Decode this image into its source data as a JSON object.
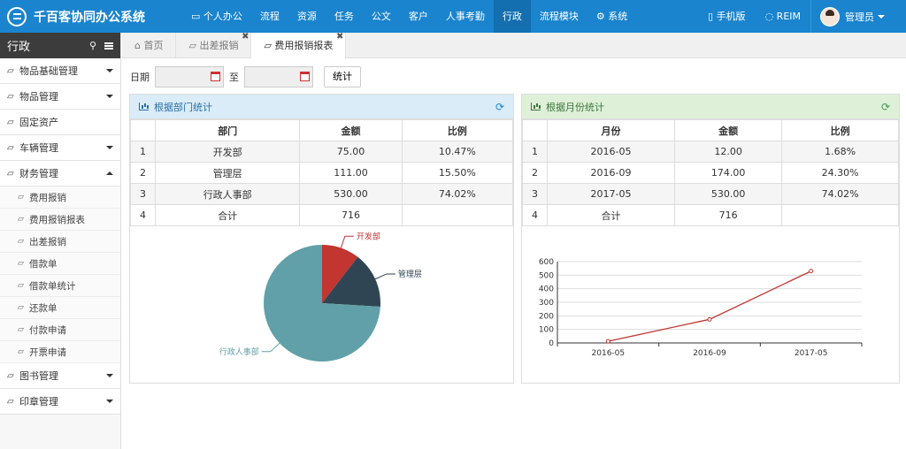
{
  "app": {
    "title": "千百客协同办公系统"
  },
  "nav": [
    {
      "label": "个人办公",
      "icon": "monitor-icon"
    },
    {
      "label": "流程"
    },
    {
      "label": "资源"
    },
    {
      "label": "任务"
    },
    {
      "label": "公文"
    },
    {
      "label": "客户"
    },
    {
      "label": "人事考勤"
    },
    {
      "label": "行政",
      "active": true
    },
    {
      "label": "流程模块"
    },
    {
      "label": "系统",
      "icon": "gear-icon"
    }
  ],
  "nav_right": {
    "mobile": "手机版",
    "reim": "REIM",
    "user": "管理员"
  },
  "sidebar": {
    "title": "行政",
    "items": [
      {
        "label": "物品基础管理",
        "expand": "down"
      },
      {
        "label": "物品管理",
        "expand": "down"
      },
      {
        "label": "固定资产"
      },
      {
        "label": "车辆管理",
        "expand": "down"
      },
      {
        "label": "财务管理",
        "expand": "up"
      }
    ],
    "finance_subs": [
      "费用报销",
      "费用报销报表",
      "出差报销",
      "借款单",
      "借款单统计",
      "还款单",
      "付款申请",
      "开票申请"
    ],
    "items_after": [
      {
        "label": "图书管理",
        "expand": "down"
      },
      {
        "label": "印章管理",
        "expand": "down"
      }
    ]
  },
  "tabs": [
    {
      "label": "首页"
    },
    {
      "label": "出差报销",
      "closable": true
    },
    {
      "label": "费用报销报表",
      "closable": true,
      "active": true
    }
  ],
  "filter": {
    "date_label": "日期",
    "to_label": "至",
    "stat_button": "统计"
  },
  "dept_panel": {
    "title": "根据部门统计",
    "headers": [
      "部门",
      "金额",
      "比例"
    ],
    "rows": [
      {
        "idx": "1",
        "name": "开发部",
        "amount": "75.00",
        "ratio": "10.47%"
      },
      {
        "idx": "2",
        "name": "管理层",
        "amount": "111.00",
        "ratio": "15.50%"
      },
      {
        "idx": "3",
        "name": "行政人事部",
        "amount": "530.00",
        "ratio": "74.02%"
      },
      {
        "idx": "4",
        "name": "合计",
        "amount": "716",
        "ratio": ""
      }
    ]
  },
  "month_panel": {
    "title": "根据月份统计",
    "headers": [
      "月份",
      "金额",
      "比例"
    ],
    "rows": [
      {
        "idx": "1",
        "name": "2016-05",
        "amount": "12.00",
        "ratio": "1.68%"
      },
      {
        "idx": "2",
        "name": "2016-09",
        "amount": "174.00",
        "ratio": "24.30%"
      },
      {
        "idx": "3",
        "name": "2017-05",
        "amount": "530.00",
        "ratio": "74.02%"
      },
      {
        "idx": "4",
        "name": "合计",
        "amount": "716",
        "ratio": ""
      }
    ]
  },
  "colors": {
    "topbar": "#1a84ce",
    "pie": [
      "#c23531",
      "#2f4554",
      "#61a0a8"
    ],
    "line": "#c23531"
  },
  "chart_data": [
    {
      "type": "pie",
      "categories": [
        "开发部",
        "管理层",
        "行政人事部"
      ],
      "values": [
        75,
        111,
        530
      ],
      "legend": "none"
    },
    {
      "type": "line",
      "x": [
        "2016-05",
        "2016-09",
        "2017-05"
      ],
      "series": [
        {
          "values": [
            12,
            174,
            530
          ]
        }
      ],
      "ylim": [
        0,
        600
      ],
      "yticks": [
        0,
        100,
        200,
        300,
        400,
        500,
        600
      ],
      "grid": true
    }
  ]
}
